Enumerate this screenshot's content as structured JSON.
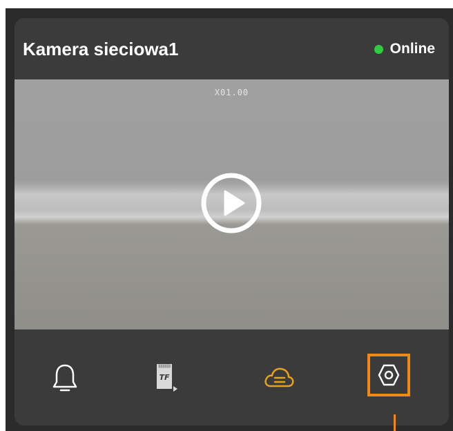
{
  "camera": {
    "title": "Kamera sieciowa1",
    "status": "Online",
    "status_color": "#2ecc40"
  },
  "video": {
    "zoom_label": "X01.00"
  },
  "toolbar": {
    "items": [
      {
        "icon": "bell-icon"
      },
      {
        "icon": "tf-card-icon",
        "glyph": "TF"
      },
      {
        "icon": "cloud-storage-icon",
        "color": "#e8a317"
      },
      {
        "icon": "settings-icon",
        "highlight_color": "#ef8a19"
      }
    ]
  }
}
